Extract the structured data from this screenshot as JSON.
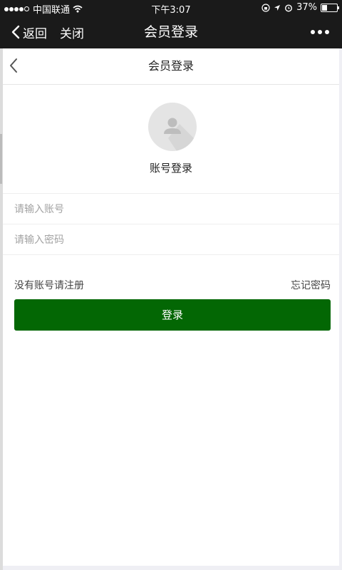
{
  "status_bar": {
    "carrier": "中国联通",
    "time": "下午3:07",
    "battery": "37%",
    "battery_level": 0.37,
    "icons": [
      "signal-dots-icon",
      "wifi-icon",
      "lock-rotation-icon",
      "location-arrow-icon",
      "alarm-icon",
      "battery-icon"
    ]
  },
  "navbar": {
    "back_label": "返回",
    "close_label": "关闭",
    "title": "会员登录",
    "more_icon": "more-dots-icon"
  },
  "page": {
    "header_title": "会员登录",
    "back_icon": "chevron-left-icon",
    "avatar_icon": "user-silhouette-icon",
    "login_title": "账号登录",
    "account_placeholder": "请输入账号",
    "account_value": "",
    "password_placeholder": "请输入密码",
    "password_value": "",
    "register_link": "没有账号请注册",
    "forgot_link": "忘记密码",
    "login_button": "登录"
  },
  "colors": {
    "accent": "#036704",
    "bar_background": "#1a1a1a"
  }
}
